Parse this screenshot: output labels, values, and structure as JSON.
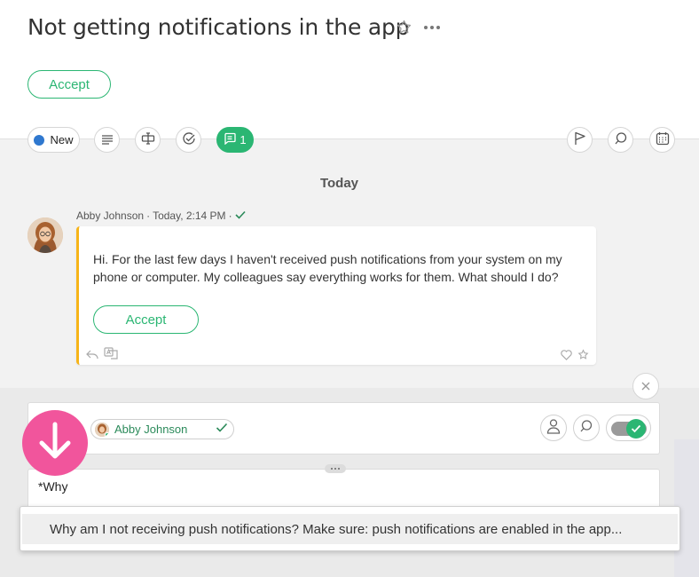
{
  "ticket": {
    "title": "Not getting notifications in the app",
    "accept_label": "Accept"
  },
  "toolbar": {
    "status_label": "New",
    "status_color": "#2f78cf",
    "chat_count": "1",
    "accent": "#2bb673"
  },
  "feed": {
    "day_label": "Today",
    "message": {
      "author": "Abby Johnson",
      "time": "Today, 2:14 PM",
      "text": "Hi. For the last few days I haven't received push notifications from your system on my phone or computer. My colleagues say everything works for them. What should I do?",
      "accept_label": "Accept"
    }
  },
  "composer": {
    "recipient": "Abby Johnson",
    "editor_text": "*Why",
    "suggestion": "Why am I not receiving push notifications? Make sure: push notifications are enabled in the app..."
  },
  "icons": [
    "star-icon",
    "more-icon",
    "list-icon",
    "field-icon",
    "check-circle-icon",
    "chat-icon",
    "flag-icon",
    "search-icon",
    "calendar-icon",
    "reply-icon",
    "translate-icon",
    "heart-icon",
    "close-icon",
    "user-icon",
    "arrow-down-icon"
  ]
}
